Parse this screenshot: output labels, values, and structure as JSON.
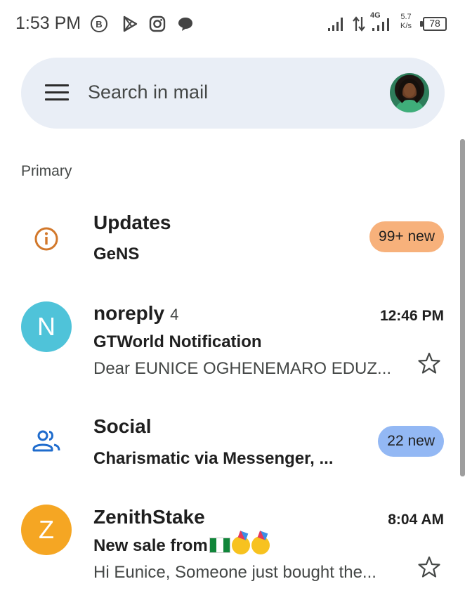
{
  "status_bar": {
    "time": "1:53 PM",
    "net_type": "4G",
    "net_speed_value": "5.7",
    "net_speed_unit": "K/s",
    "battery": "78",
    "notification_icons": [
      "business-b-icon",
      "play-store-icon",
      "instagram-icon",
      "chat-bubble-icon"
    ]
  },
  "search": {
    "placeholder": "Search in mail"
  },
  "section_label": "Primary",
  "rows": [
    {
      "kind": "category",
      "icon": "info-icon",
      "title": "Updates",
      "subtitle": "GeNS",
      "badge": "99+ new",
      "badge_color": "#f7b17b"
    },
    {
      "kind": "email",
      "avatar_letter": "N",
      "avatar_color": "#4fc3d9",
      "title": "noreply",
      "count": "4",
      "time": "12:46 PM",
      "subject": "GTWorld Notification",
      "preview": "Dear EUNICE OGHENEMARO EDUZ..."
    },
    {
      "kind": "category",
      "icon": "people-icon",
      "title": "Social",
      "subtitle": "Charismatic via Messenger, ...",
      "badge": "22 new",
      "badge_color": "#93b8f4"
    },
    {
      "kind": "email",
      "avatar_letter": "Z",
      "avatar_color": "#f5a623",
      "title": "ZenithStake",
      "time": "8:04 AM",
      "subject": "New sale from",
      "preview": "Hi Eunice, Someone just bought the..."
    }
  ],
  "colors": {
    "info_icon": "#d2782b",
    "people_icon": "#1f6ccd",
    "search_bg": "#e9eef6"
  }
}
